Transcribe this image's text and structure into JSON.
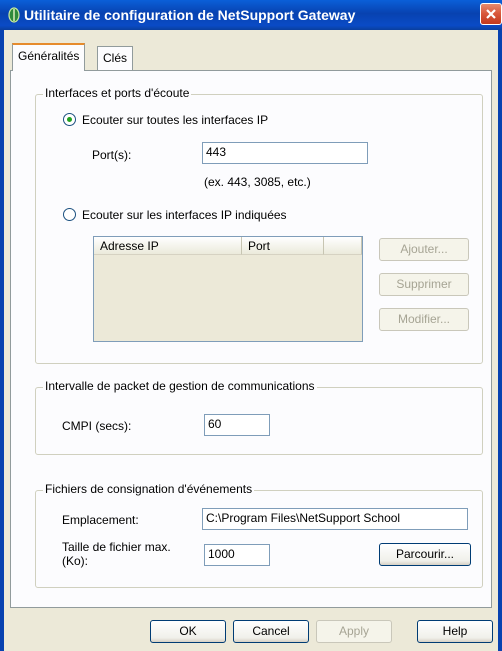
{
  "window": {
    "title": "Utilitaire de configuration de NetSupport Gateway"
  },
  "tabs": [
    {
      "label": "Généralités",
      "active": true
    },
    {
      "label": "Clés",
      "active": false
    }
  ],
  "listen_group": {
    "label": "Interfaces et ports d'écoute",
    "radio_all_label": "Ecouter sur toutes les interfaces IP",
    "radio_all_checked": true,
    "port_label": "Port(s):",
    "port_value": "443",
    "port_hint": "(ex. 443, 3085, etc.)",
    "radio_specific_label": "Ecouter sur les interfaces IP indiquées",
    "radio_specific_checked": false,
    "list_columns": [
      "Adresse IP",
      "Port",
      ""
    ],
    "list_rows": [],
    "add_button": "Ajouter...",
    "remove_button": "Supprimer",
    "modify_button": "Modifier..."
  },
  "cmpi_group": {
    "label": "Intervalle de packet de gestion de communications",
    "field_label": "CMPI (secs):",
    "field_value": "60"
  },
  "log_group": {
    "label": "Fichiers de consignation d'événements",
    "location_label": "Emplacement:",
    "location_value": "C:\\Program Files\\NetSupport School",
    "maxsize_label_line1": "Taille de fichier max.",
    "maxsize_label_line2": "(Ko):",
    "maxsize_value": "1000",
    "browse_button": "Parcourir..."
  },
  "dialog_buttons": {
    "ok": "OK",
    "cancel": "Cancel",
    "apply": "Apply",
    "help": "Help"
  },
  "colors": {
    "titlebar": "#0842b0",
    "window_bg": "#ece9d8",
    "panel_bg": "#fcfcfe",
    "tab_highlight": "#e68b2c",
    "radio_dot": "#21a121"
  },
  "icons": {
    "app": "netsupport-gateway-icon",
    "close": "close-icon"
  }
}
